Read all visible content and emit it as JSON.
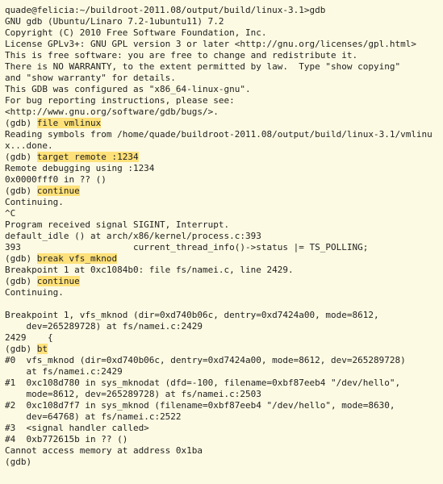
{
  "lines": [
    {
      "segments": [
        {
          "t": "quade@felicia:~/buildroot-2011.08/output/build/linux-3.1>gdb"
        }
      ]
    },
    {
      "segments": [
        {
          "t": "GNU gdb (Ubuntu/Linaro 7.2-1ubuntu11) 7.2"
        }
      ]
    },
    {
      "segments": [
        {
          "t": "Copyright (C) 2010 Free Software Foundation, Inc."
        }
      ]
    },
    {
      "segments": [
        {
          "t": "License GPLv3+: GNU GPL version 3 or later <http://gnu.org/licenses/gpl.html>"
        }
      ]
    },
    {
      "segments": [
        {
          "t": "This is free software: you are free to change and redistribute it."
        }
      ]
    },
    {
      "segments": [
        {
          "t": "There is NO WARRANTY, to the extent permitted by law.  Type \"show copying\""
        }
      ]
    },
    {
      "segments": [
        {
          "t": "and \"show warranty\" for details."
        }
      ]
    },
    {
      "segments": [
        {
          "t": "This GDB was configured as \"x86_64-linux-gnu\"."
        }
      ]
    },
    {
      "segments": [
        {
          "t": "For bug reporting instructions, please see:"
        }
      ]
    },
    {
      "segments": [
        {
          "t": "<http://www.gnu.org/software/gdb/bugs/>."
        }
      ]
    },
    {
      "segments": [
        {
          "t": "(gdb) "
        },
        {
          "t": "file vmlinux",
          "hl": true
        }
      ]
    },
    {
      "segments": [
        {
          "t": "Reading symbols from /home/quade/buildroot-2011.08/output/build/linux-3.1/vmlinux...done."
        }
      ]
    },
    {
      "segments": [
        {
          "t": "(gdb) "
        },
        {
          "t": "target remote :1234",
          "hl": true
        }
      ]
    },
    {
      "segments": [
        {
          "t": "Remote debugging using :1234"
        }
      ]
    },
    {
      "segments": [
        {
          "t": "0x0000fff0 in ?? ()"
        }
      ]
    },
    {
      "segments": [
        {
          "t": "(gdb) "
        },
        {
          "t": "continue",
          "hl": true
        }
      ]
    },
    {
      "segments": [
        {
          "t": "Continuing."
        }
      ]
    },
    {
      "segments": [
        {
          "t": "^C"
        }
      ]
    },
    {
      "segments": [
        {
          "t": "Program received signal SIGINT, Interrupt."
        }
      ]
    },
    {
      "segments": [
        {
          "t": "default_idle () at arch/x86/kernel/process.c:393"
        }
      ]
    },
    {
      "segments": [
        {
          "t": "393                     current_thread_info()->status |= TS_POLLING;"
        }
      ]
    },
    {
      "segments": [
        {
          "t": "(gdb) "
        },
        {
          "t": "break vfs_mknod",
          "hl": true
        }
      ]
    },
    {
      "segments": [
        {
          "t": "Breakpoint 1 at 0xc1084b0: file fs/namei.c, line 2429."
        }
      ]
    },
    {
      "segments": [
        {
          "t": "(gdb) "
        },
        {
          "t": "continue",
          "hl": true
        }
      ]
    },
    {
      "segments": [
        {
          "t": "Continuing."
        }
      ]
    },
    {
      "segments": [
        {
          "t": " "
        }
      ]
    },
    {
      "segments": [
        {
          "t": "Breakpoint 1, vfs_mknod (dir=0xd740b06c, dentry=0xd7424a00, mode=8612,"
        }
      ]
    },
    {
      "segments": [
        {
          "t": "    dev=265289728) at fs/namei.c:2429"
        }
      ]
    },
    {
      "segments": [
        {
          "t": "2429    {"
        }
      ]
    },
    {
      "segments": [
        {
          "t": "(gdb) "
        },
        {
          "t": "bt",
          "hl": true
        }
      ]
    },
    {
      "segments": [
        {
          "t": "#0  vfs_mknod (dir=0xd740b06c, dentry=0xd7424a00, mode=8612, dev=265289728)"
        }
      ]
    },
    {
      "segments": [
        {
          "t": "    at fs/namei.c:2429"
        }
      ]
    },
    {
      "segments": [
        {
          "t": "#1  0xc108d780 in sys_mknodat (dfd=-100, filename=0xbf87eeb4 \"/dev/hello\","
        }
      ]
    },
    {
      "segments": [
        {
          "t": "    mode=8612, dev=265289728) at fs/namei.c:2503"
        }
      ]
    },
    {
      "segments": [
        {
          "t": "#2  0xc108d7f7 in sys_mknod (filename=0xbf87eeb4 \"/dev/hello\", mode=8630,"
        }
      ]
    },
    {
      "segments": [
        {
          "t": "    dev=64768) at fs/namei.c:2522"
        }
      ]
    },
    {
      "segments": [
        {
          "t": "#3  <signal handler called>"
        }
      ]
    },
    {
      "segments": [
        {
          "t": "#4  0xb772615b in ?? ()"
        }
      ]
    },
    {
      "segments": [
        {
          "t": "Cannot access memory at address 0x1ba"
        }
      ]
    },
    {
      "segments": [
        {
          "t": "(gdb)"
        }
      ]
    }
  ]
}
